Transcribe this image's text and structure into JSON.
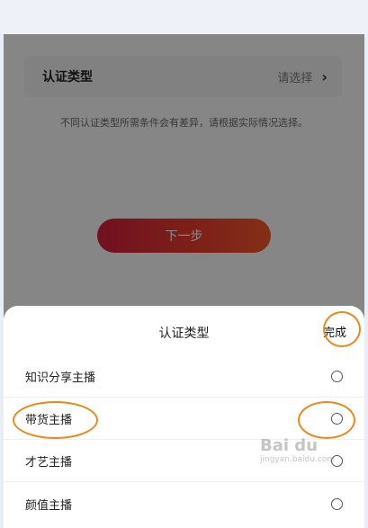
{
  "page": {
    "cert_label": "认证类型",
    "cert_value": "请选择",
    "hint": "不同认证类型所需条件会有差异，请根据实际情况选择。",
    "next_button": "下一步"
  },
  "sheet": {
    "title": "认证类型",
    "done": "完成",
    "options": [
      {
        "label": "知识分享主播"
      },
      {
        "label": "带货主播"
      },
      {
        "label": "才艺主播"
      },
      {
        "label": "颜值主播"
      }
    ]
  },
  "watermark": {
    "main": "Bai du",
    "sub": "jingyan.baidu.com"
  },
  "colors": {
    "accent_ring": "#e8891c",
    "button_start": "#cf1f3c",
    "button_end": "#f0552b"
  },
  "icons": {
    "chevron": "chevron-right-icon",
    "radio": "radio-unchecked-icon"
  }
}
